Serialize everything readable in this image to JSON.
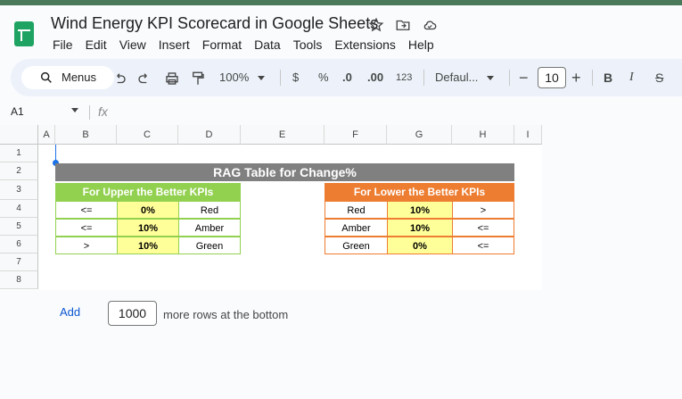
{
  "doc": {
    "title": "Wind Energy KPI Scorecard in Google Sheets"
  },
  "menu": [
    "File",
    "Edit",
    "View",
    "Insert",
    "Format",
    "Data",
    "Tools",
    "Extensions",
    "Help"
  ],
  "toolbar": {
    "menus_label": "Menus",
    "zoom": "100%",
    "currency": "$",
    "percent": "%",
    "dec_decrease": ".0",
    "dec_increase": ".00",
    "number_format": "123",
    "font": "Defaul...",
    "minus": "−",
    "font_size": "10",
    "plus": "+",
    "bold": "B",
    "italic": "I",
    "strike": "S"
  },
  "formula_bar": {
    "cell_ref": "A1",
    "fx": "fx"
  },
  "columns": [
    "A",
    "B",
    "C",
    "D",
    "E",
    "F",
    "G",
    "H",
    "I"
  ],
  "rows": [
    "1",
    "2",
    "3",
    "4",
    "5",
    "6",
    "7",
    "8"
  ],
  "rag": {
    "title": "RAG Table for Change%",
    "upper": {
      "title": "For Upper the Better KPIs",
      "rows": [
        [
          "<=",
          "0%",
          "Red"
        ],
        [
          "<=",
          "10%",
          "Amber"
        ],
        [
          ">",
          "10%",
          "Green"
        ]
      ]
    },
    "lower": {
      "title": "For Lower the Better KPIs",
      "rows": [
        [
          "Red",
          "10%",
          ">"
        ],
        [
          "Amber",
          "10%",
          "<="
        ],
        [
          "Green",
          "0%",
          "<="
        ]
      ]
    }
  },
  "footer": {
    "add_label": "Add",
    "rows_value": "1000",
    "rows_text": "more rows at the bottom"
  },
  "colors": {
    "header_gray": "#808080",
    "upper_green": "#92d050",
    "lower_orange": "#ed7d31",
    "value_yellow": "#ffff99"
  }
}
